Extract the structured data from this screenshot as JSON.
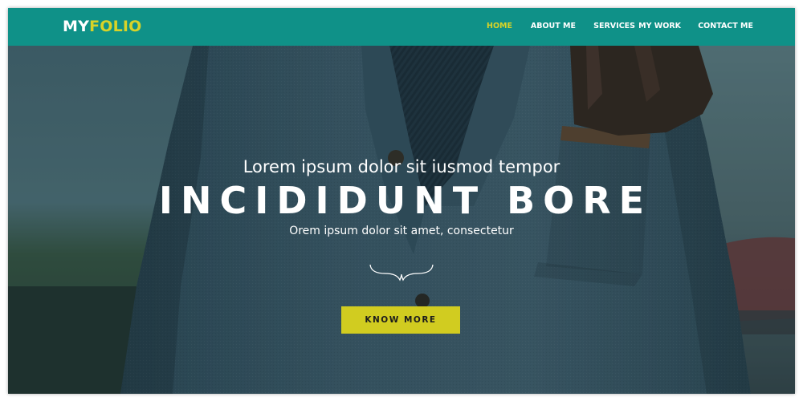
{
  "brand": {
    "part1": "MY",
    "part2": "FOLIO"
  },
  "nav": {
    "items": [
      {
        "label": "HOME",
        "active": true
      },
      {
        "label": "ABOUT ME",
        "active": false
      },
      {
        "label": "SERVICES",
        "active": false
      },
      {
        "label": "MY WORK",
        "active": false
      },
      {
        "label": "CONTACT ME",
        "active": false
      }
    ]
  },
  "hero": {
    "kicker": "Lorem ipsum dolor sit iusmod tempor",
    "headline": "INCIDIDUNT BORE",
    "subline": "Orem ipsum dolor sit amet, consectetur",
    "cta_label": "KNOW MORE",
    "background_image": "man in grey tweed jacket holding brown leather gloves"
  },
  "colors": {
    "navbar": "#0f9188",
    "accent": "#d8d328",
    "cta": "#d1cc20",
    "text": "#ffffff"
  }
}
